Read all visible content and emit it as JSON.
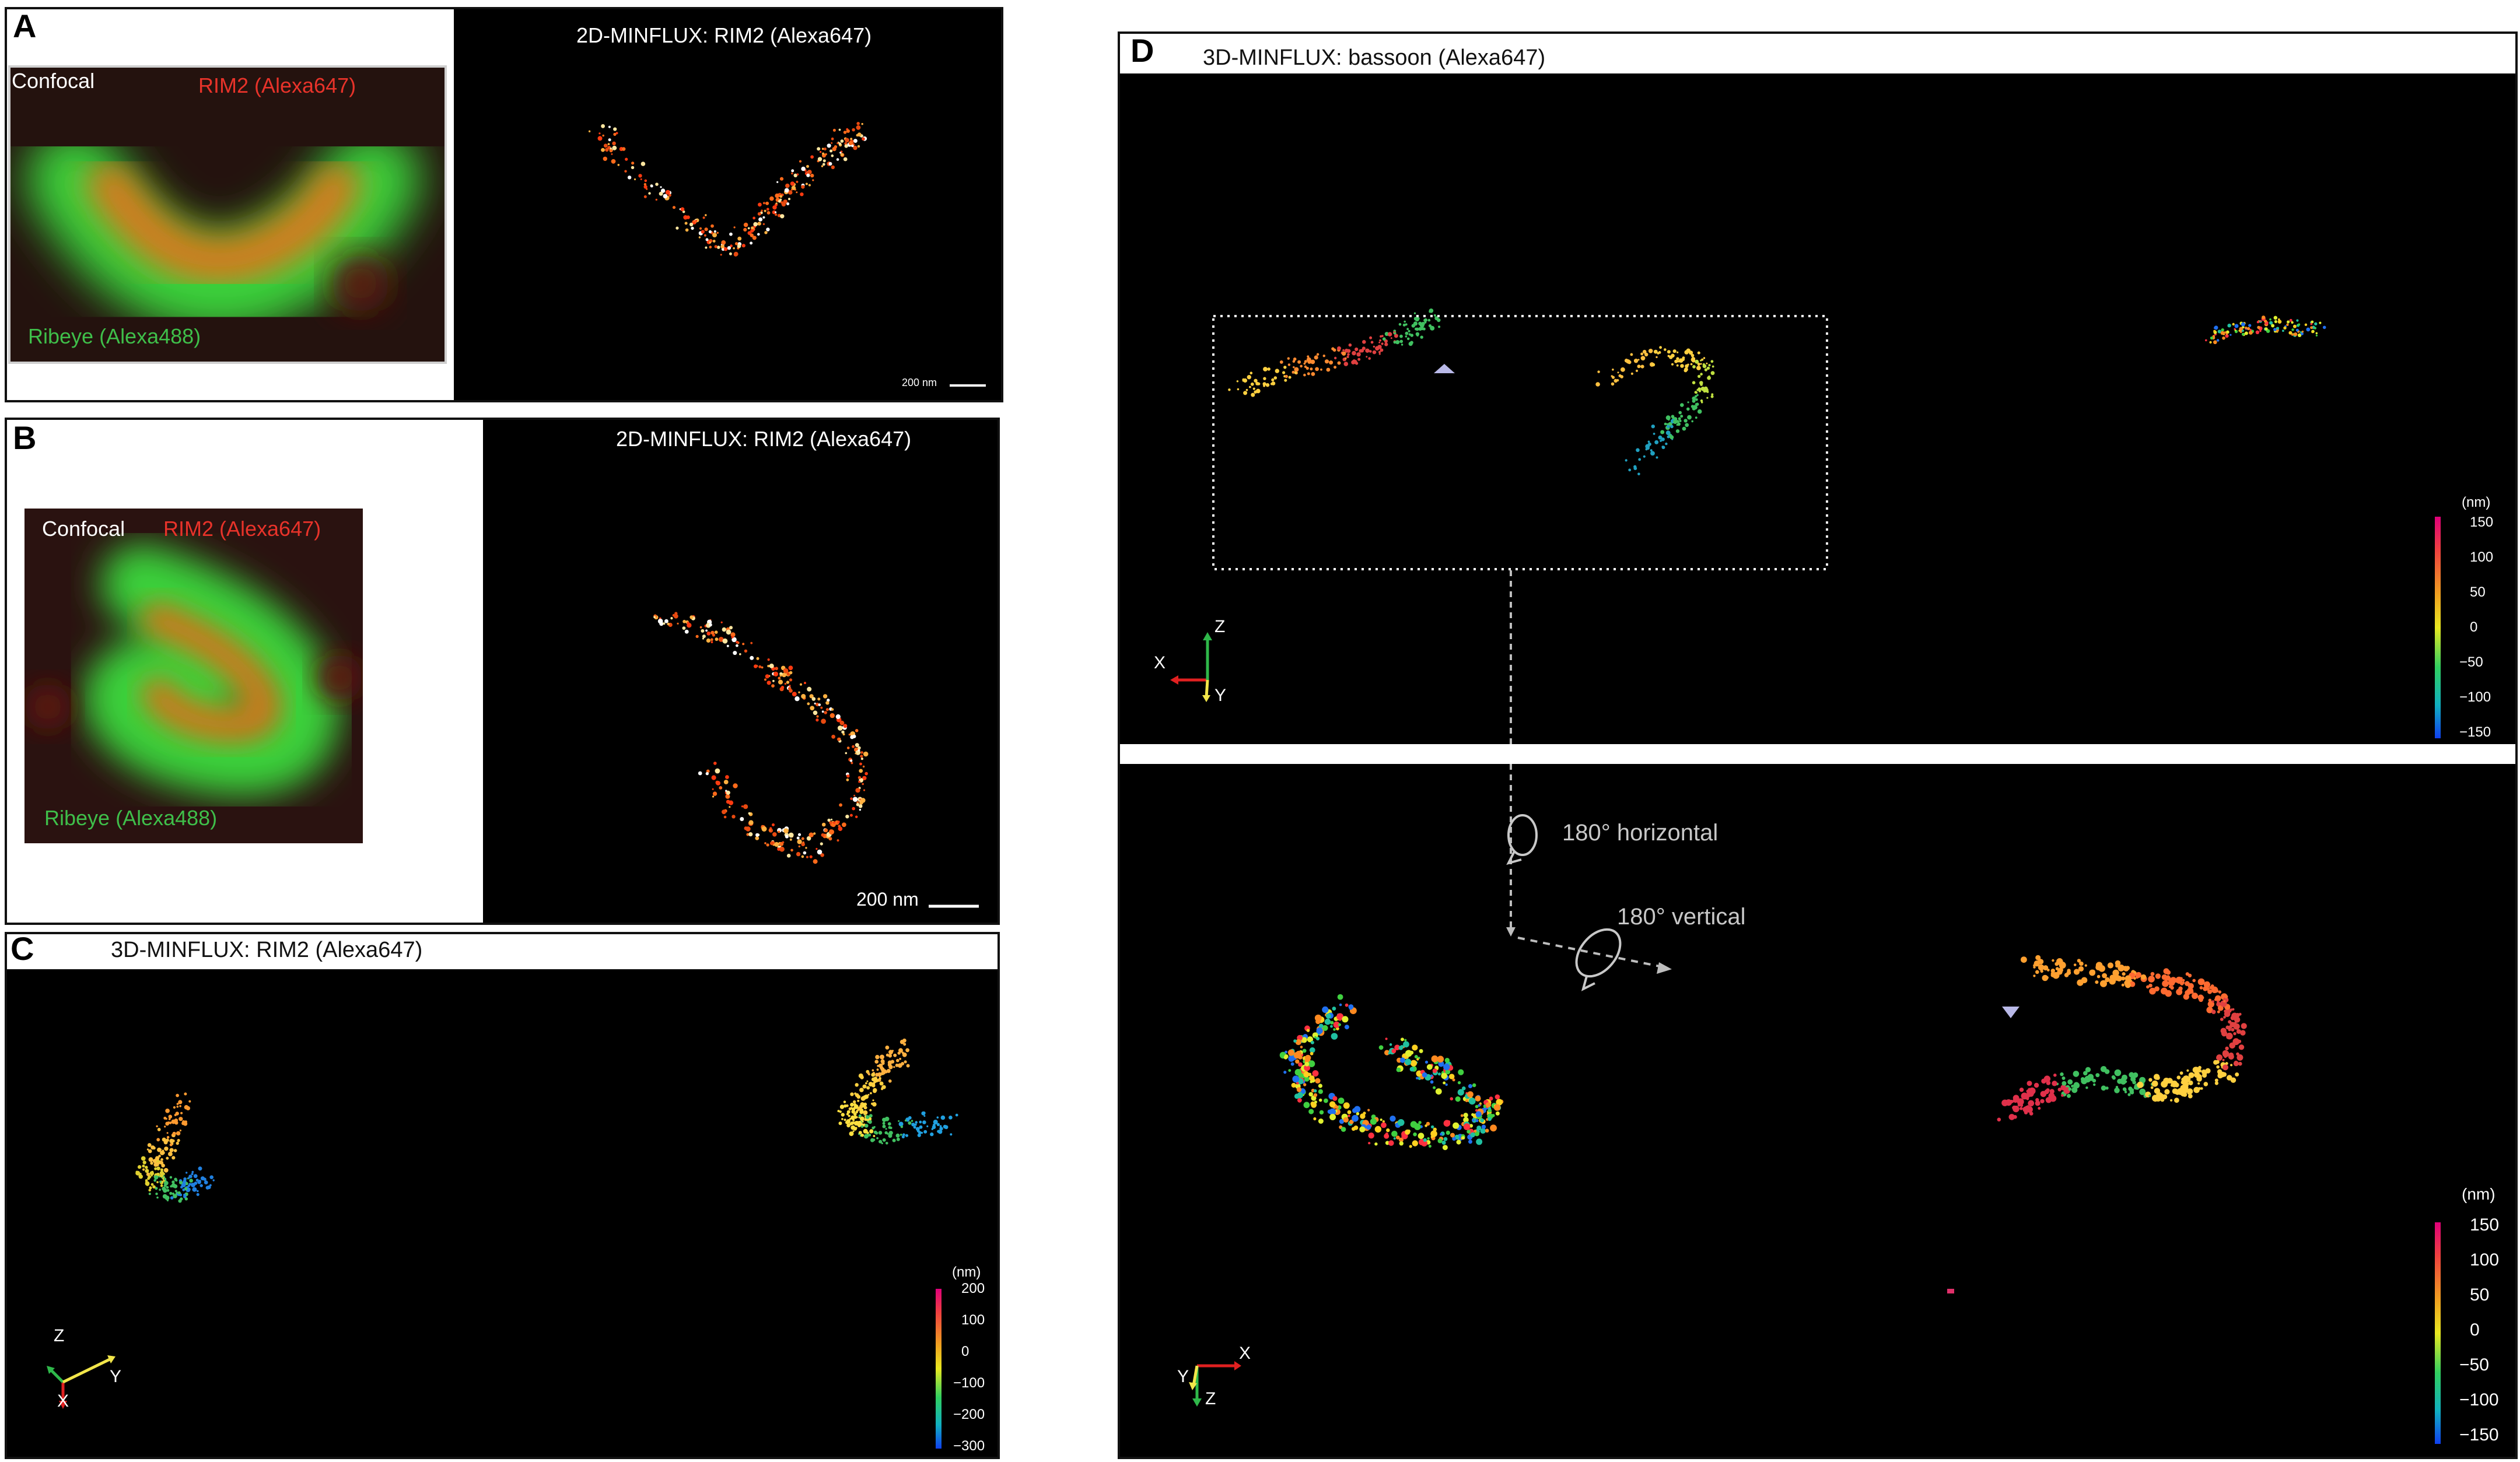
{
  "panel_A": {
    "letter": "A",
    "confocal_label": "Confocal",
    "rim2_label": "RIM2 (Alexa647)",
    "ribeye_label": "Ribeye (Alexa488)",
    "title": "2D-MINFLUX: RIM2 (Alexa647)",
    "scale_bar": "200 nm"
  },
  "panel_B": {
    "letter": "B",
    "confocal_label": "Confocal",
    "rim2_label": "RIM2 (Alexa647)",
    "ribeye_label": "Ribeye (Alexa488)",
    "title": "2D-MINFLUX: RIM2 (Alexa647)",
    "scale_bar": "200 nm"
  },
  "panel_C": {
    "letter": "C",
    "title": "3D-MINFLUX: RIM2 (Alexa647)",
    "colorbar_unit": "(nm)",
    "colorbar_ticks": [
      "200",
      "100",
      "0",
      "−100",
      "−200",
      "−300"
    ],
    "axes": {
      "z": "Z",
      "y": "Y",
      "x": "X"
    }
  },
  "panel_D": {
    "letter": "D",
    "title": "3D-MINFLUX: bassoon (Alexa647)",
    "rotation_1": "180° horizontal",
    "rotation_2": "180° vertical",
    "colorbar_unit": "(nm)",
    "colorbar_ticks": [
      "150",
      "100",
      "50",
      "0",
      "−50",
      "−100",
      "−150"
    ],
    "colorbar2_ticks": [
      "150",
      "100",
      "50",
      "0",
      "−50",
      "−100",
      "−150"
    ],
    "axes_top": {
      "z": "Z",
      "x": "X",
      "y": "Y"
    },
    "axes_bottom": {
      "x": "X",
      "y": "Y",
      "z": "Z"
    }
  },
  "colors": {
    "background": "#000000",
    "rim2_red": "#e8332a",
    "ribeye_green": "#3fbf4a",
    "axis_x_red": "#e02020",
    "axis_z_green": "#2fb84a",
    "axis_y_yellow": "#f2e64a"
  }
}
